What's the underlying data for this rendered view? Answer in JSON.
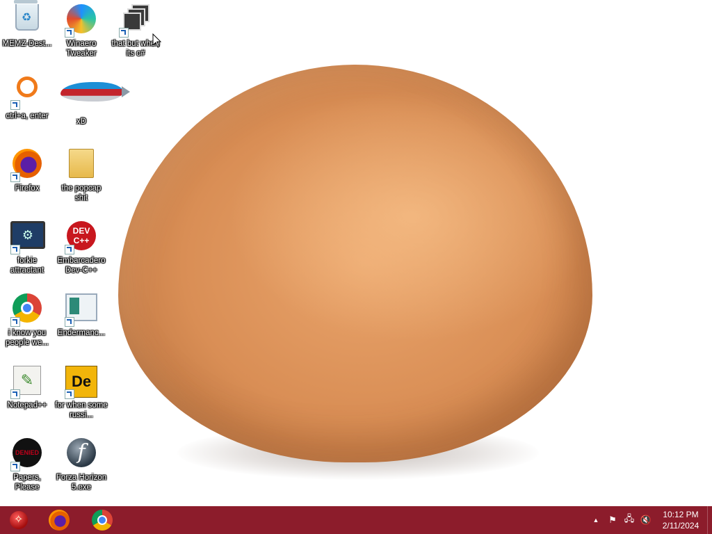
{
  "desktop": {
    "icons": [
      {
        "label": "MEMZ-Dest...",
        "icon": "recycle-bin-icon"
      },
      {
        "label": "Winaero Tweaker",
        "icon": "winaero-icon"
      },
      {
        "label": "that but when its c#",
        "icon": "stacked-windows-icon"
      },
      {
        "label": "ctrl+a, enter",
        "icon": "magnifier-icon"
      },
      {
        "label": "xD",
        "icon": "fish-icon"
      },
      {
        "label": "Firefox",
        "icon": "firefox-icon"
      },
      {
        "label": "the popcap shit",
        "icon": "folder-icon"
      },
      {
        "label": "forkie attractant",
        "icon": "gear-monitor-icon"
      },
      {
        "label": "Embarcadero Dev-C++",
        "icon": "devcpp-icon"
      },
      {
        "label": "i know you people we...",
        "icon": "chrome-icon"
      },
      {
        "label": "Endermanc...",
        "icon": "document-icon"
      },
      {
        "label": "Notepad++",
        "icon": "notepadpp-icon"
      },
      {
        "label": "for when some russi...",
        "icon": "de-icon"
      },
      {
        "label": "Papers, Please",
        "icon": "papers-please-icon"
      },
      {
        "label": "Forza Horizon 5.exe",
        "icon": "flash-icon"
      }
    ],
    "devcpp_text": "DEV C++",
    "de_text": "De",
    "papers_text": "DENIED",
    "flash_text": "f"
  },
  "taskbar": {
    "color": "#8c1c2b",
    "pinned": [
      "start-orb-icon",
      "firefox-icon",
      "chrome-icon"
    ],
    "tray": {
      "show_hidden": "▲",
      "flag": "⚑",
      "network": "🖧",
      "volume": "🔇"
    },
    "clock": {
      "time": "10:12 PM",
      "date": "2/11/2024"
    }
  }
}
